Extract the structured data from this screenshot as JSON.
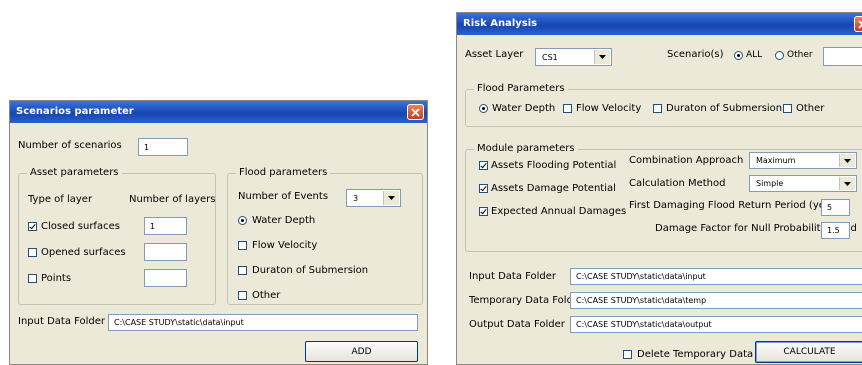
{
  "scenarios_window": {
    "title": "Scenarios parameter",
    "number_of_scenarios_label": "Number of scenarios",
    "number_of_scenarios_value": "1",
    "asset_group": {
      "title": "Asset parameters",
      "type_of_layer_header": "Type of layer",
      "number_of_layers_header": "Number of layers",
      "rows": [
        {
          "label": "Closed surfaces",
          "checked": true,
          "value": "1"
        },
        {
          "label": "Opened surfaces",
          "checked": false,
          "value": ""
        },
        {
          "label": "Points",
          "checked": false,
          "value": ""
        }
      ]
    },
    "flood_group": {
      "title": "Flood parameters",
      "events_label": "Number of Events",
      "events_value": "3",
      "options": [
        {
          "label": "Water Depth",
          "kind": "radio",
          "checked": true
        },
        {
          "label": "Flow Velocity",
          "kind": "check",
          "checked": false
        },
        {
          "label": "Duraton of Submersion",
          "kind": "check",
          "checked": false
        },
        {
          "label": "Other",
          "kind": "check",
          "checked": false
        }
      ]
    },
    "input_folder_label": "Input Data Folder",
    "input_folder_value": "C:\\CASE STUDY\\static\\data\\input",
    "add_button": "ADD"
  },
  "risk_window": {
    "title": "Risk Analysis",
    "asset_layer_label": "Asset Layer",
    "asset_layer_value": "CS1",
    "scenarios_label": "Scenario(s)",
    "scenario_all_label": "ALL",
    "scenario_other_label": "Other",
    "scenario_selected": "ALL",
    "flood_group": {
      "title": "Flood Parameters",
      "options": [
        {
          "label": "Water Depth",
          "kind": "radio",
          "checked": true
        },
        {
          "label": "Flow Velocity",
          "kind": "check",
          "checked": false
        },
        {
          "label": "Duraton of Submersion",
          "kind": "check",
          "checked": false
        },
        {
          "label": "Other",
          "kind": "check",
          "checked": false
        }
      ]
    },
    "module_group": {
      "title": "Module parameters",
      "checks": [
        {
          "label": "Assets Flooding Potential",
          "checked": true
        },
        {
          "label": "Assets Damage Potential",
          "checked": true
        },
        {
          "label": "Expected Annual Damages",
          "checked": true
        }
      ],
      "combination_label": "Combination Approach",
      "combination_value": "Maximum",
      "calculation_label": "Calculation Method",
      "calculation_value": "Simple",
      "return_period_label": "First Damaging Flood Return Period (years)",
      "return_period_value": "5",
      "null_prob_label": "Damage Factor for Null Probability Flood",
      "null_prob_value": "1.5"
    },
    "input_folder_label": "Input Data Folder",
    "input_folder_value": "C:\\CASE STUDY\\static\\data\\input",
    "temp_folder_label": "Temporary Data Folder",
    "temp_folder_value": "C:\\CASE STUDY\\static\\data\\temp",
    "output_folder_label": "Output Data Folder",
    "output_folder_value": "C:\\CASE STUDY\\static\\data\\output",
    "delete_temp_label": "Delete Temporary Data",
    "delete_temp_checked": false,
    "calculate_button": "CALCULATE"
  }
}
